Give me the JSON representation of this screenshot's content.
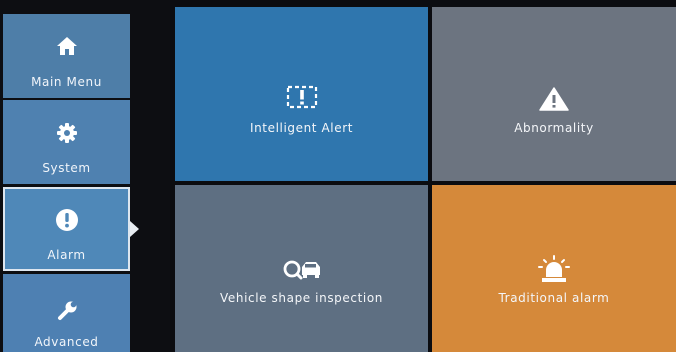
{
  "sidebar": {
    "items": [
      {
        "label": "Main Menu",
        "icon": "home-icon"
      },
      {
        "label": "System",
        "icon": "gear-icon"
      },
      {
        "label": "Alarm",
        "icon": "alert-circle-icon",
        "selected": true
      },
      {
        "label": "Advanced",
        "icon": "wrench-icon"
      }
    ]
  },
  "tiles": [
    {
      "label": "Intelligent Alert",
      "icon": "intelligent-alert-icon",
      "color": "#2f76ae"
    },
    {
      "label": "Abnormality",
      "icon": "warning-triangle-icon",
      "color": "#6c7480"
    },
    {
      "label": "Vehicle shape inspection",
      "icon": "vehicle-search-icon",
      "color": "#5e6f82"
    },
    {
      "label": "Traditional alarm",
      "icon": "siren-icon",
      "color": "#d5893a"
    }
  ],
  "colors": {
    "background": "#0b0c10",
    "nav_item": "#4f81b0",
    "nav_selected_border": "#dde6ef"
  }
}
